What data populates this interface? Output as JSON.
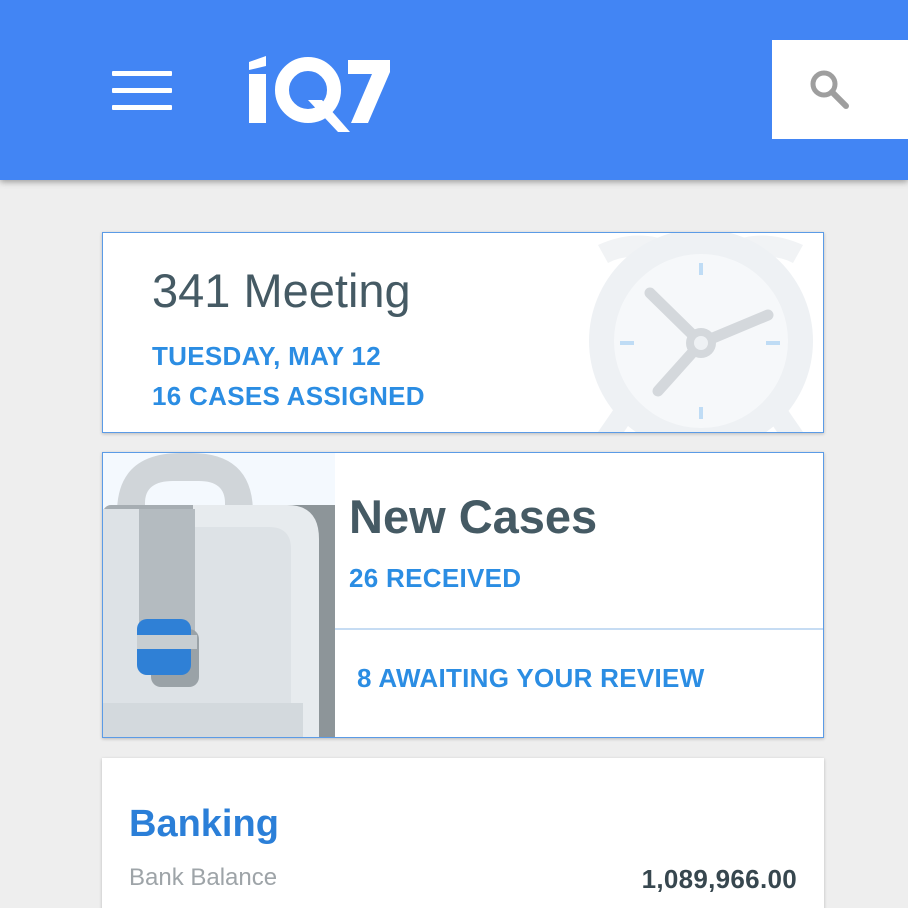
{
  "app": {
    "logo_text": "IQ7"
  },
  "colors": {
    "appbar": "#4285f4",
    "accent": "#2b8de3",
    "title": "#455a64",
    "background": "#eeeeee"
  },
  "icons": {
    "menu": "hamburger-menu-icon",
    "search": "search-icon"
  },
  "meeting": {
    "title": "341 Meeting",
    "date": "TUESDAY, MAY 12",
    "cases_assigned": "16 CASES ASSIGNED"
  },
  "new_cases": {
    "title": "New Cases",
    "received": "26 RECEIVED",
    "awaiting_review": "8 AWAITING YOUR REVIEW"
  },
  "banking": {
    "title": "Banking",
    "balance_label": "Bank Balance",
    "balance_value": "1,089,966.00"
  }
}
